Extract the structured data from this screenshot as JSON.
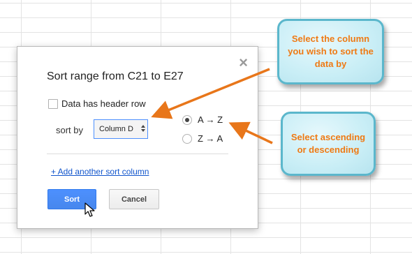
{
  "dialog": {
    "title": "Sort range from C21 to E27",
    "close_glyph": "×",
    "header_checkbox_label": "Data has header row",
    "sort_by_label": "sort by",
    "column_select_value": "Column D",
    "radio_asc_label": "A → Z",
    "radio_desc_label": "Z → A",
    "selected_order": "A → Z",
    "add_sort_column_link": "+ Add another sort column",
    "sort_button": "Sort",
    "cancel_button": "Cancel"
  },
  "callouts": {
    "column": "Select the column you wish to sort the data by",
    "order": "Select ascending or descending"
  },
  "colors": {
    "accent_blue": "#4d90fe",
    "callout_text": "#ef7a14",
    "callout_border": "#5bb7cc",
    "arrow": "#e8761a"
  },
  "icons": {
    "close": "close-icon",
    "select_arrows": "up-down-arrows-icon",
    "cursor": "mouse-pointer-icon"
  }
}
